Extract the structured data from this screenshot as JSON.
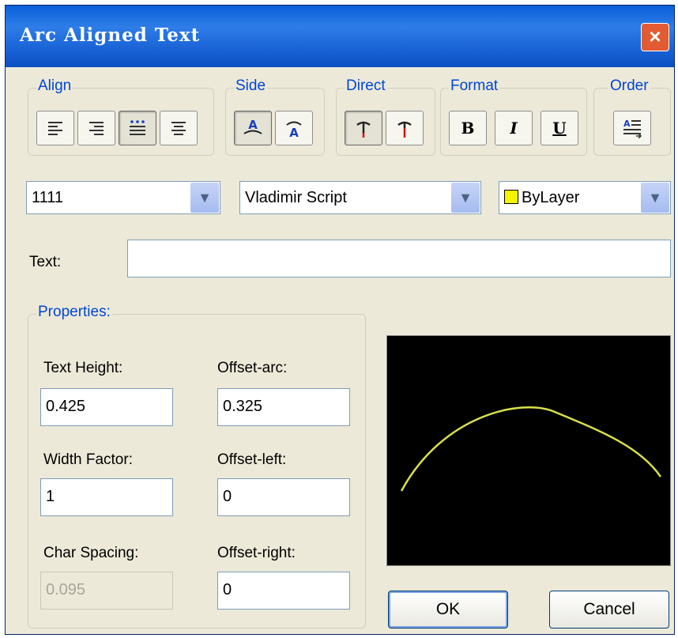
{
  "window": {
    "title": "Arc Aligned Text",
    "close_glyph": "×"
  },
  "toolbar": {
    "groups": {
      "align": {
        "label": "Align",
        "buttons": [
          "align-left-icon",
          "align-right-icon",
          "align-fit-icon",
          "align-center-icon"
        ]
      },
      "side": {
        "label": "Side",
        "buttons": [
          "convex-side-icon",
          "concave-side-icon"
        ]
      },
      "direct": {
        "label": "Direct",
        "buttons": [
          "outward-direction-icon",
          "inward-direction-icon"
        ]
      },
      "format": {
        "label": "Format",
        "bold": "B",
        "italic": "I",
        "underline": "U"
      },
      "order": {
        "label": "Order",
        "buttons": [
          "reverse-order-icon"
        ]
      }
    }
  },
  "selectors": {
    "style": {
      "value": "1111"
    },
    "font": {
      "value": "Vladimir Script"
    },
    "color": {
      "value": "ByLayer",
      "swatch": "#f5f500"
    }
  },
  "text_field": {
    "label": "Text:",
    "value": ""
  },
  "properties": {
    "label": "Properties:",
    "text_height": {
      "label": "Text Height:",
      "value": "0.425"
    },
    "offset_arc": {
      "label": "Offset-arc:",
      "value": "0.325"
    },
    "width_factor": {
      "label": "Width Factor:",
      "value": "1"
    },
    "offset_left": {
      "label": "Offset-left:",
      "value": "0"
    },
    "char_spacing": {
      "label": "Char Spacing:",
      "value": "0.095"
    },
    "offset_right": {
      "label": "Offset-right:",
      "value": "0"
    }
  },
  "preview": {
    "arc_color": "#d8e04a"
  },
  "buttons": {
    "ok": "OK",
    "cancel": "Cancel"
  }
}
